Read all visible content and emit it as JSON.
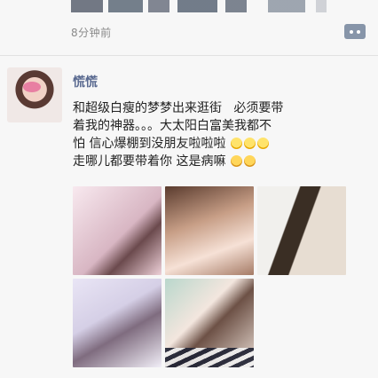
{
  "previous_post": {
    "time": "8分钟前"
  },
  "post": {
    "author": "慌慌",
    "text_lines": [
      "和超级白瘦的梦梦出来逛街   必须要带",
      "着我的神器。。。大太阳白富美我都不",
      "怕 信心爆棚到没朋友啦啦啦"
    ],
    "text_line4": "走哪儿都要带着你 这是病嘛",
    "emoji_line3": [
      "laugh-emoji",
      "laugh-emoji",
      "laugh-emoji"
    ],
    "emoji_line4": [
      "smile-emoji",
      "smile-emoji"
    ]
  },
  "photos": [
    "photo-1",
    "photo-2",
    "photo-3",
    "photo-4",
    "photo-5"
  ],
  "colors": {
    "author_name": "#5b6b91",
    "timestamp": "#8a8a8a",
    "comment_button": "#8795a9",
    "background": "#f7f7f7"
  }
}
